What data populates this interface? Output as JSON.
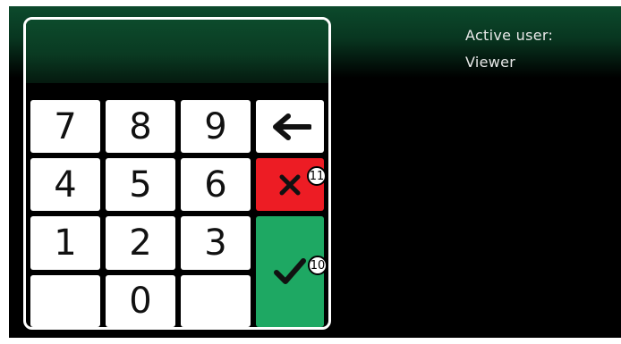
{
  "user": {
    "label": "Active user:",
    "name": "Viewer"
  },
  "keypad": {
    "keys": {
      "k7": "7",
      "k8": "8",
      "k9": "9",
      "k4": "4",
      "k5": "5",
      "k6": "6",
      "k1": "1",
      "k2": "2",
      "k3": "3",
      "k0": "0"
    },
    "backspace_icon": "left-arrow-icon",
    "cancel_icon": "cross-icon",
    "confirm_icon": "checkmark-icon"
  },
  "callouts": {
    "cancel": "11",
    "confirm": "10"
  },
  "colors": {
    "cancel": "#ed1c24",
    "confirm": "#1ea863",
    "header_green": "#0c4a2c"
  }
}
